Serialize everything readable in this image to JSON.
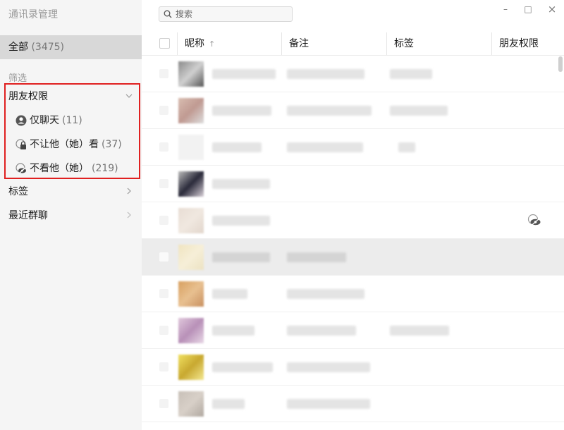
{
  "app": {
    "title": "通讯录管理"
  },
  "sidebar": {
    "all": {
      "label": "全部",
      "count": "(3475)"
    },
    "filter_label": "筛选",
    "friend_permission": {
      "label": "朋友权限",
      "items": [
        {
          "label": "仅聊天",
          "count": "(11)",
          "icon": "person-icon"
        },
        {
          "label": "不让他（她）看",
          "count": "(37)",
          "icon": "lock-icon"
        },
        {
          "label": "不看他（她）",
          "count": "(219)",
          "icon": "hidden-eye-icon"
        }
      ]
    },
    "tags": {
      "label": "标签"
    },
    "recent_groups": {
      "label": "最近群聊"
    }
  },
  "search": {
    "placeholder": "搜索"
  },
  "window_controls": {
    "minimize": "–",
    "maximize": "□",
    "close": "×"
  },
  "table": {
    "columns": [
      {
        "label": "昵称",
        "sort": "↑"
      },
      {
        "label": "备注"
      },
      {
        "label": "标签"
      },
      {
        "label": "朋友权限"
      }
    ],
    "rows": [
      {
        "has_permission_icon": false
      },
      {
        "has_permission_icon": false
      },
      {
        "has_permission_icon": false
      },
      {
        "has_permission_icon": false
      },
      {
        "has_permission_icon": true,
        "permission_icon": "hidden-eye-icon"
      },
      {
        "has_permission_icon": false,
        "selected": true
      },
      {
        "has_permission_icon": false
      },
      {
        "has_permission_icon": false
      },
      {
        "has_permission_icon": false
      },
      {
        "has_permission_icon": false
      }
    ]
  },
  "colors": {
    "highlight_border": "#e02020",
    "sidebar_bg": "#f5f5f5",
    "selected_bg": "#d8d8d8"
  }
}
